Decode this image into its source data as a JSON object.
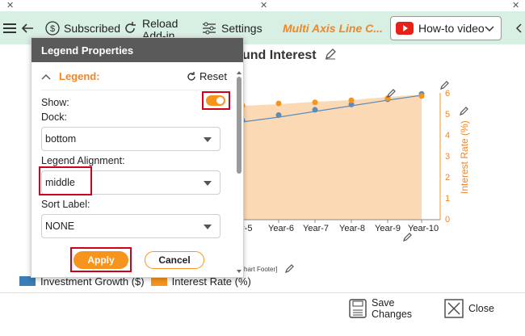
{
  "toolbar": {
    "subscribed": "Subscribed",
    "reload": "Reload Add-in",
    "reload_line1": "Reload",
    "reload_line2": "Add-in",
    "settings": "Settings",
    "brand": "Multi Axis Line C...",
    "howto": "How-to video"
  },
  "chart": {
    "title": "und Interest",
    "x_ticks": [
      "r-5",
      "Year-6",
      "Year-7",
      "Year-8",
      "Year-9",
      "Year-10"
    ],
    "right_ticks": [
      "6",
      "5",
      "4",
      "3",
      "2",
      "1",
      "0"
    ],
    "right_label": "Interest Rate (%)",
    "footer_text": "hart Footer]",
    "colors": {
      "growth": "#5b8db8",
      "rate": "#f7941d",
      "area": "#fcd2a8"
    }
  },
  "chart_data": {
    "type": "line",
    "categories": [
      "Year-5",
      "Year-6",
      "Year-7",
      "Year-8",
      "Year-9",
      "Year-10"
    ],
    "series": [
      {
        "name": "Investment Growth ($)",
        "values": [
          4.7,
          4.95,
          5.2,
          5.45,
          5.7,
          5.95
        ]
      },
      {
        "name": "Interest Rate (%)",
        "values": [
          5.4,
          5.5,
          5.55,
          5.65,
          5.75,
          5.85
        ]
      }
    ],
    "right_ylim": [
      0,
      6
    ],
    "ylabel_right": "Interest Rate (%)"
  },
  "legend_row": {
    "item1": "Investment Growth ($)",
    "item2": "Interest Rate (%)"
  },
  "panel": {
    "title": "Legend Properties",
    "section": "Legend:",
    "reset": "Reset",
    "show_label": "Show:",
    "dock_label": "Dock:",
    "dock_value": "bottom",
    "align_label": "Legend Alignment:",
    "align_value": "middle",
    "sort_label": "Sort Label:",
    "sort_value": "NONE",
    "apply": "Apply",
    "cancel": "Cancel",
    "show_on": true
  },
  "footer": {
    "save": "Save Changes",
    "save_line1": "Save",
    "save_line2": "Changes",
    "close": "Close"
  }
}
